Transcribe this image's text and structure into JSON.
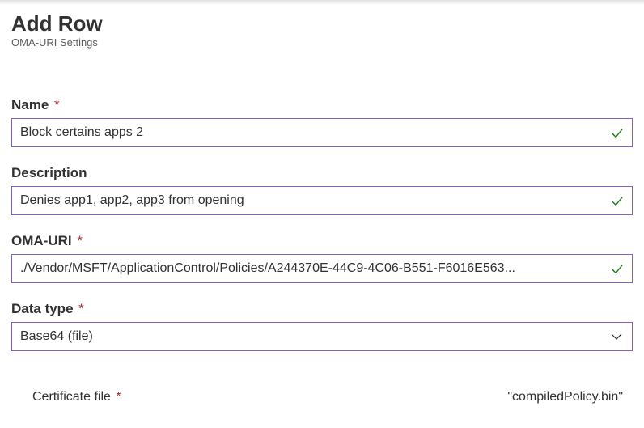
{
  "header": {
    "title": "Add Row",
    "subtitle": "OMA-URI Settings"
  },
  "fields": {
    "name": {
      "label": "Name",
      "required": true,
      "value": "Block certains apps 2",
      "valid": true
    },
    "description": {
      "label": "Description",
      "required": false,
      "value": "Denies app1, app2, app3 from opening",
      "valid": true
    },
    "oma_uri": {
      "label": "OMA-URI",
      "required": true,
      "value": "./Vendor/MSFT/ApplicationControl/Policies/A244370E-44C9-4C06-B551-F6016E563...",
      "valid": true
    },
    "data_type": {
      "label": "Data type",
      "required": true,
      "value": "Base64 (file)"
    },
    "certificate_file": {
      "label": "Certificate file",
      "required": true,
      "filename": "\"compiledPolicy.bin\""
    }
  },
  "required_marker": "*"
}
